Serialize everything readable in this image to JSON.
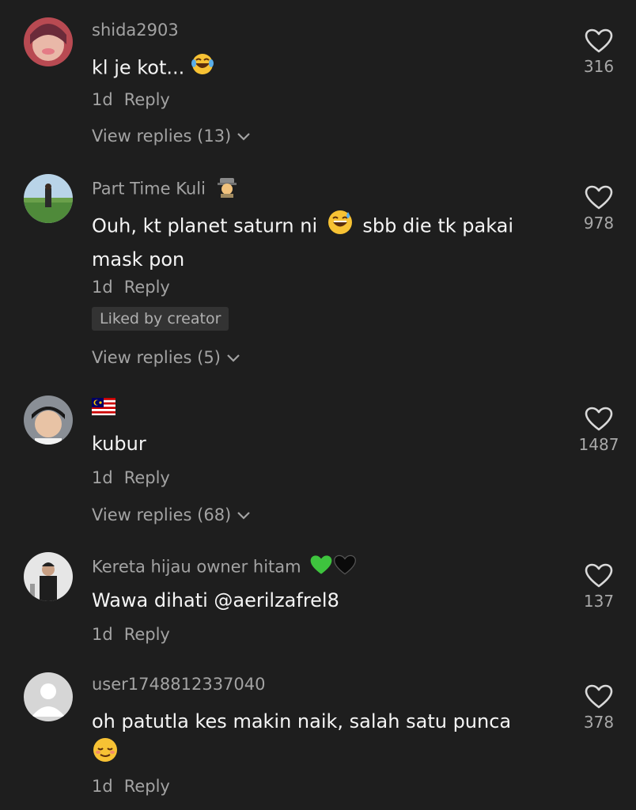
{
  "comments": [
    {
      "username": "shida2903",
      "text": "kl je kot...",
      "text_emoji": "laughing-tears-emoji",
      "time": "1d",
      "reply_label": "Reply",
      "view_replies": "View replies (13)",
      "likes": "316"
    },
    {
      "username": "Part Time Kuli",
      "username_emoji": "detective-emoji",
      "text_part1": "Ouh, kt planet saturn ni",
      "text_emoji": "sweat-smile-emoji",
      "text_part2": "sbb die tk pakai",
      "text_line2": "mask pon",
      "time": "1d",
      "reply_label": "Reply",
      "liked_badge": "Liked by creator",
      "view_replies": "View replies (5)",
      "likes": "978"
    },
    {
      "username_emoji": "malaysia-flag-emoji",
      "text": "kubur",
      "time": "1d",
      "reply_label": "Reply",
      "view_replies": "View replies (68)",
      "likes": "1487"
    },
    {
      "username": "Kereta hijau owner hitam",
      "username_emojis": [
        "green-heart-emoji",
        "black-heart-emoji"
      ],
      "text": "Wawa dihati @aerilzafrel8",
      "time": "1d",
      "reply_label": "Reply",
      "likes": "137"
    },
    {
      "username": "user1748812337040",
      "text": "oh patutla kes makin naik, salah satu punca",
      "text_emoji": "relieved-emoji",
      "time": "1d",
      "reply_label": "Reply",
      "likes": "378"
    }
  ],
  "colors": {
    "background": "#1e1e1e",
    "muted_text": "#a3a3a3",
    "body_text": "#f5f5f5",
    "badge_bg": "#333333"
  }
}
